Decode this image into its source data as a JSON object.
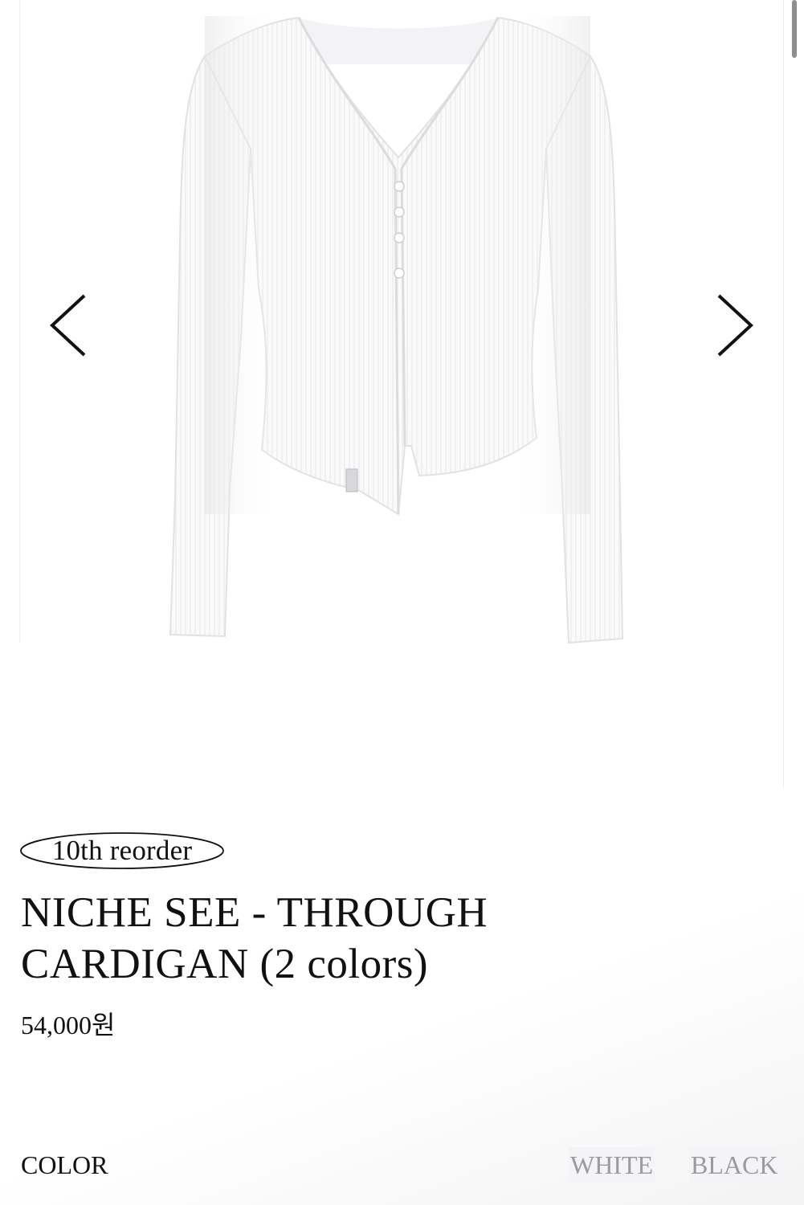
{
  "product": {
    "badge": "10th reorder",
    "title": "NICHE SEE - THROUGH CARDIGAN (2 colors)",
    "price": "54,000원",
    "image": "white-ribbed-see-through-cardigan"
  },
  "gallery": {
    "prev_icon": "chevron-left-icon",
    "next_icon": "chevron-right-icon"
  },
  "options": {
    "label": "COLOR",
    "colors": [
      {
        "label": "WHITE",
        "swatch": "#ffffff"
      },
      {
        "label": "BLACK",
        "swatch": "#000000"
      }
    ]
  },
  "colors": {
    "text": "#111111",
    "option_text": "#9a9aa0",
    "option_bg": "#f4f4f6"
  }
}
